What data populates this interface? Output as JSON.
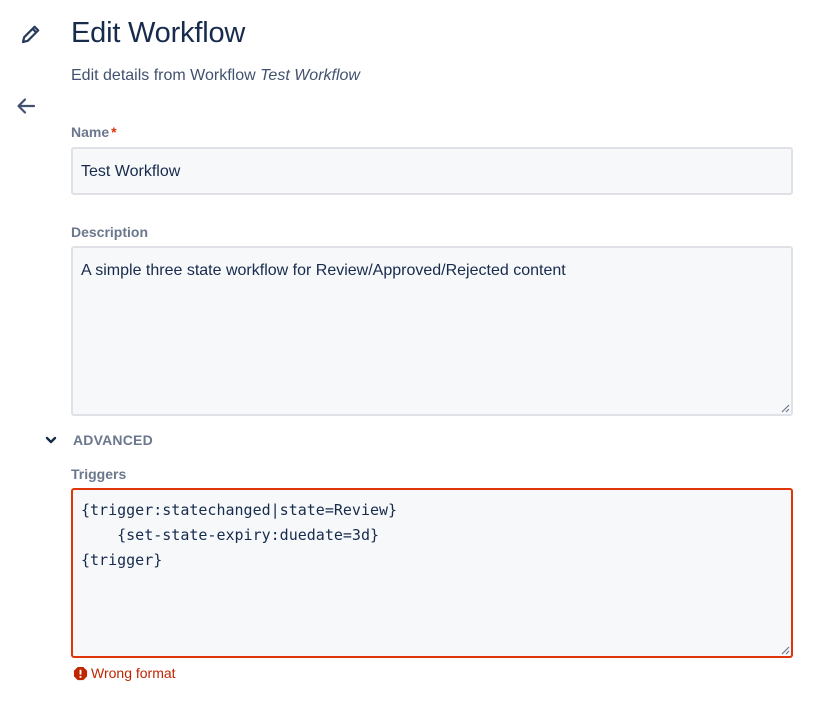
{
  "header": {
    "title": "Edit Workflow",
    "subtitle_prefix": "Edit details from Workflow",
    "subtitle_name": "Test Workflow"
  },
  "icons": {
    "edit": "pencil-icon",
    "back": "arrow-left-icon",
    "advanced_toggle": "chevron-down-icon",
    "error": "warning-icon"
  },
  "form": {
    "name": {
      "label": "Name",
      "required_marker": "*",
      "value": "Test Workflow"
    },
    "description": {
      "label": "Description",
      "value": "A simple three state workflow for Review/Approved/Rejected content"
    },
    "advanced": {
      "label": "ADVANCED",
      "expanded": true
    },
    "triggers": {
      "label": "Triggers",
      "value": "{trigger:statechanged|state=Review}\n    {set-state-expiry:duedate=3d}\n{trigger}",
      "error": "Wrong format"
    }
  },
  "colors": {
    "text_primary": "#172b4d",
    "label": "#6b778c",
    "error_border": "#de350b",
    "error_text": "#bf2600",
    "field_bg": "#f7f8fa",
    "field_border": "#dfe1e6"
  }
}
